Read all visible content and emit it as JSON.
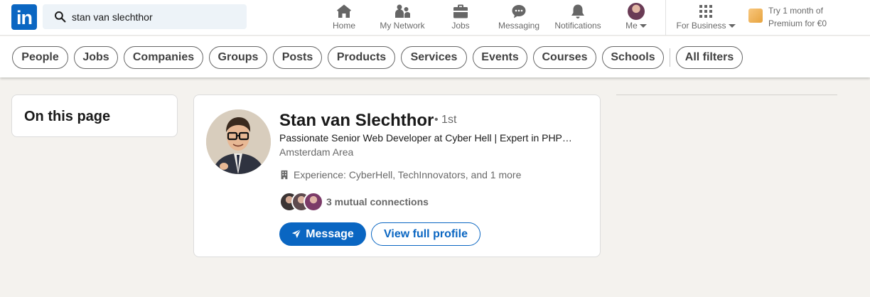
{
  "colors": {
    "brand": "#0a66c2",
    "background": "#f4f2ee",
    "premium": "#e7a33e"
  },
  "logo": {
    "text": "in"
  },
  "search": {
    "value": "stan van slechthor",
    "icon": "search-icon"
  },
  "nav": {
    "home": "Home",
    "network": "My Network",
    "jobs": "Jobs",
    "messaging": "Messaging",
    "notifications": "Notifications",
    "me": "Me",
    "business": "For Business",
    "premium_line1": "Try 1 month of",
    "premium_line2": "Premium for €0"
  },
  "filters": [
    "People",
    "Jobs",
    "Companies",
    "Groups",
    "Posts",
    "Products",
    "Services",
    "Events",
    "Courses",
    "Schools"
  ],
  "all_filters": "All filters",
  "sidebar": {
    "title": "On this page"
  },
  "result": {
    "name": "Stan van Slechthor",
    "degree": "• 1st",
    "headline": "Passionate Senior Web Developer at Cyber Hell | Expert in PHP…",
    "location": "Amsterdam Area",
    "experience": "Experience: CyberHell, TechInnovators, and 1 more",
    "mutual": "3 mutual connections",
    "message_label": "Message",
    "view_label": "View full profile"
  }
}
